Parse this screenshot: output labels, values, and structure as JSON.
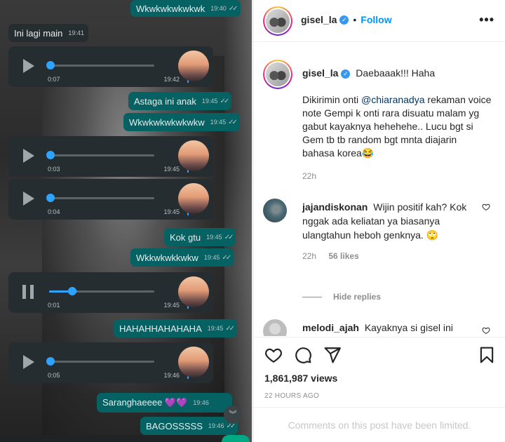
{
  "chat": {
    "messages": [
      {
        "type": "text",
        "dir": "out",
        "text": "Wkwkwkwkwkwk",
        "time": "19:40"
      },
      {
        "type": "text",
        "dir": "in",
        "text": "Ini lagi main",
        "time": "19:41"
      },
      {
        "type": "voice",
        "duration": "0:07",
        "time": "19:42",
        "progress": 0
      },
      {
        "type": "text",
        "dir": "out",
        "text": "Astaga ini anak",
        "time": "19:45"
      },
      {
        "type": "text",
        "dir": "out",
        "text": "Wkwkwkwkwkwkw",
        "time": "19:45"
      },
      {
        "type": "voice",
        "duration": "0:03",
        "time": "19:45",
        "progress": 0
      },
      {
        "type": "voice",
        "duration": "0:04",
        "time": "19:45",
        "progress": 0
      },
      {
        "type": "text",
        "dir": "out",
        "text": "Kok gtu",
        "time": "19:45"
      },
      {
        "type": "text",
        "dir": "out",
        "text": "Wkkwkwkkwkw",
        "time": "19:45"
      },
      {
        "type": "voice",
        "duration": "0:01",
        "time": "19:45",
        "progress": 0.25,
        "playing": true
      },
      {
        "type": "text",
        "dir": "out",
        "text": "HAHAHHAHAHAHA",
        "time": "19:45"
      },
      {
        "type": "voice",
        "duration": "0:05",
        "time": "19:46",
        "progress": 0
      },
      {
        "type": "text",
        "dir": "out",
        "text": "Saranghaeeee 💜💜",
        "time": "19:46"
      },
      {
        "type": "text",
        "dir": "out",
        "text": "BAGOSSSSS",
        "time": "19:46"
      }
    ],
    "colors": {
      "out_bubble": "#056162",
      "in_bubble": "#262d31",
      "accent": "#2ea3ff"
    },
    "icons": {
      "scroll": "chevron-double-down-icon"
    }
  },
  "header": {
    "username": "gisel_la",
    "follow_label": "Follow",
    "separator": "•",
    "more_label": "•••"
  },
  "caption": {
    "username": "gisel_la",
    "line1": "Daebaaak!!! Haha",
    "line2_pre": "Dikirimin onti ",
    "mention": "@chiaranadya",
    "line2_post": " rekaman voice note Gempi k onti rara disuatu malam yg gabut kayaknya hehehehe.. Lucu bgt si Gem tb tb random bgt mnta diajarin bahasa korea😂",
    "time": "22h"
  },
  "comments": [
    {
      "username": "jajandiskonan",
      "text": "Wijin positif kah? Kok nggak ada keliatan ya biasanya ulangtahun heboh genknya. 🙄",
      "time": "22h",
      "likes": "56 likes"
    },
    {
      "username": "melodi_ajah",
      "text": "Kayaknya si gisel ini"
    }
  ],
  "hide_replies": "Hide replies",
  "views": "1,861,987 views",
  "posted": "22 HOURS AGO",
  "limited": "Comments on this post have been limited."
}
